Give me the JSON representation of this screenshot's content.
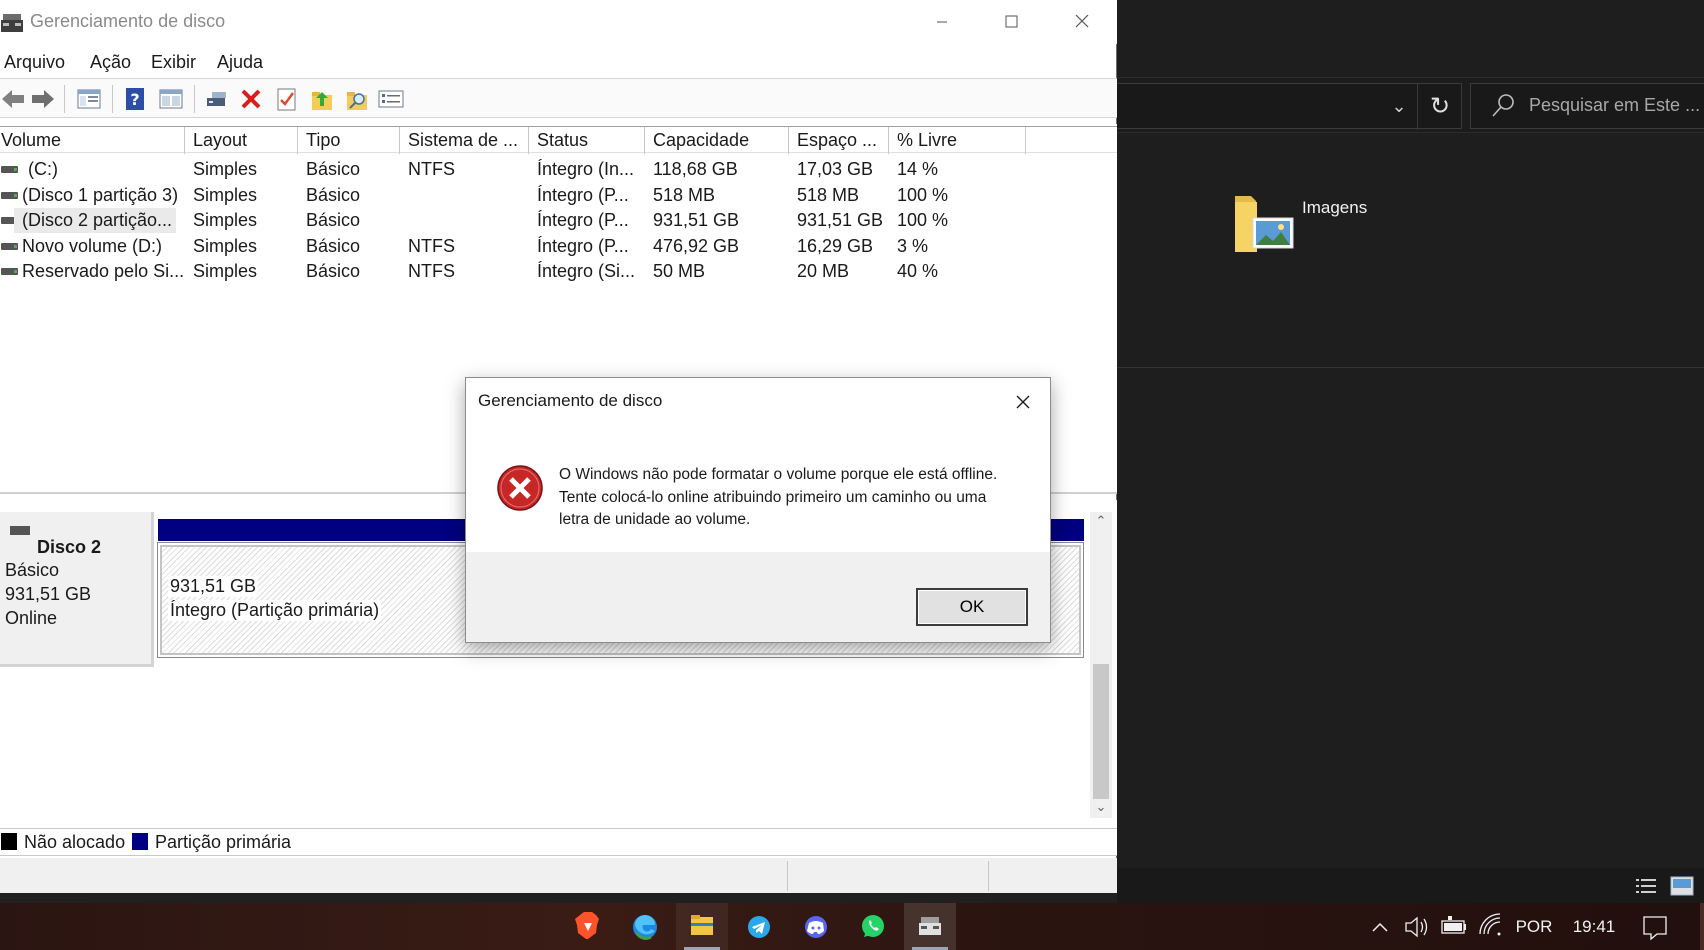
{
  "window": {
    "title": "Gerenciamento de disco"
  },
  "menu": [
    "Arquivo",
    "Ação",
    "Exibir",
    "Ajuda"
  ],
  "volumes": {
    "columns": [
      "Volume",
      "Layout",
      "Tipo",
      "Sistema de ...",
      "Status",
      "Capacidade",
      "Espaço ...",
      "% Livre"
    ],
    "rows": [
      [
        "(C:)",
        "Simples",
        "Básico",
        "NTFS",
        "Íntegro (In...",
        "118,68 GB",
        "17,03 GB",
        "14 %"
      ],
      [
        "(Disco 1 partição 3)",
        "Simples",
        "Básico",
        "",
        "Íntegro (P...",
        "518 MB",
        "518 MB",
        "100 %"
      ],
      [
        "(Disco 2 partição...",
        "Simples",
        "Básico",
        "",
        "Íntegro (P...",
        "931,51 GB",
        "931,51 GB",
        "100 %"
      ],
      [
        "Novo volume (D:)",
        "Simples",
        "Básico",
        "NTFS",
        "Íntegro (P...",
        "476,92 GB",
        "16,29 GB",
        "3 %"
      ],
      [
        "Reservado pelo Si...",
        "Simples",
        "Básico",
        "NTFS",
        "Íntegro (Si...",
        "50 MB",
        "20 MB",
        "40 %"
      ]
    ]
  },
  "disk": {
    "name": "Disco 2",
    "type": "Básico",
    "size": "931,51 GB",
    "state": "Online",
    "partition_size": "931,51 GB",
    "partition_status": "Íntegro (Partição primária)",
    "partition_bar_color": "#000080"
  },
  "legend": {
    "unallocated": "Não alocado",
    "primary": "Partição primária",
    "unallocated_color": "#000000",
    "primary_color": "#000080"
  },
  "dialog": {
    "title": "Gerenciamento de disco",
    "message_lines": [
      "O Windows não pode formatar o volume porque ele está offline.",
      "Tente colocá-lo online atribuindo primeiro um caminho ou uma",
      "letra de unidade ao volume."
    ],
    "ok_label": "OK",
    "icon": "error-icon"
  },
  "explorer": {
    "search_placeholder": "Pesquisar em Este ...",
    "folder_label": "Imagens"
  },
  "taskbar": {
    "apps": [
      "brave-icon",
      "edge-icon",
      "file-explorer-icon",
      "telegram-icon",
      "discord-icon",
      "whatsapp-icon",
      "disk-management-icon"
    ],
    "language": "POR",
    "time": "19:41"
  }
}
